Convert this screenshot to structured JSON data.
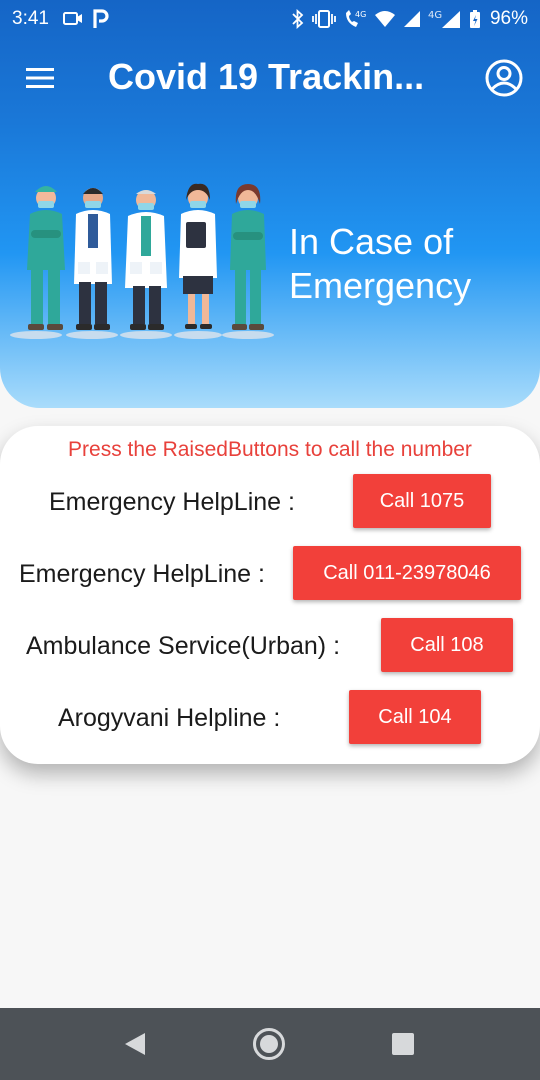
{
  "status_bar": {
    "time": "3:41",
    "network_badge_1": "4G",
    "network_badge_2": "4G",
    "battery": "96%"
  },
  "app_bar": {
    "title": "Covid 19 Trackin...",
    "menu_icon": "hamburger-menu-icon",
    "account_icon": "account-circle-icon"
  },
  "hero": {
    "line1": "In Case of",
    "line2": "Emergency"
  },
  "card": {
    "instruction": "Press the RaisedButtons to call the number",
    "rows": [
      {
        "label": "Emergency HelpLine :",
        "button": "Call 1075"
      },
      {
        "label": "Emergency HelpLine :",
        "button": "Call 011-23978046"
      },
      {
        "label": "Ambulance Service(Urban) :",
        "button": "Call 108"
      },
      {
        "label": "Arogyvani Helpline :",
        "button": "Call 104"
      }
    ]
  },
  "colors": {
    "header_top": "#1565c6",
    "header_bottom": "#a9dcfb",
    "accent_red": "#f2403a",
    "nav_bar": "#4d5257"
  }
}
